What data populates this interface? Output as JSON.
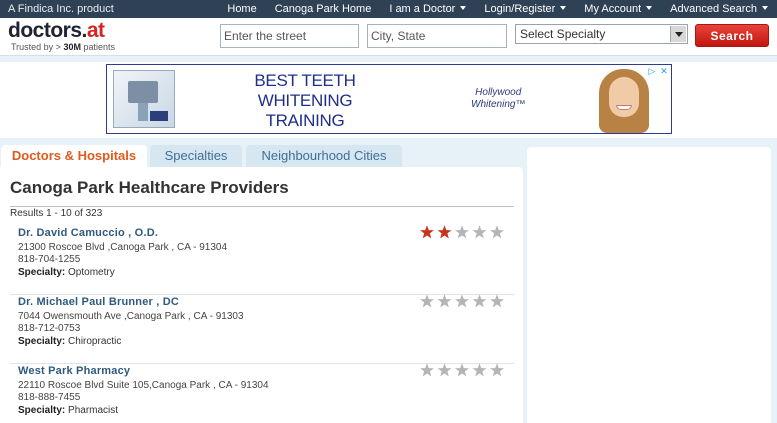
{
  "topbar": {
    "left_text": "A Findica Inc. product",
    "nav": [
      {
        "label": "Home",
        "has_caret": false
      },
      {
        "label": "Canoga Park Home",
        "has_caret": false
      },
      {
        "label": "I am a Doctor",
        "has_caret": true
      },
      {
        "label": "Login/Register",
        "has_caret": true
      },
      {
        "label": "My Account",
        "has_caret": true
      },
      {
        "label": "Advanced Search",
        "has_caret": true
      }
    ]
  },
  "header": {
    "logo_main": "doctors.",
    "logo_at": "at",
    "tagline_prefix": "Trusted by > ",
    "tagline_bold": "30M",
    "tagline_suffix": " patients",
    "street_placeholder": "Enter the street",
    "city_placeholder": "City, State",
    "specialty_selected": "Select Specialty",
    "search_label": "Search"
  },
  "ad": {
    "headline": [
      "BEST TEETH",
      "WHITENING",
      "TRAINING"
    ],
    "brand": [
      "Hollywood",
      "Whitening™"
    ],
    "icons": [
      "ad-choices-icon",
      "close-icon"
    ],
    "close_glyph": "✕"
  },
  "tabs": [
    {
      "label": "Doctors & Hospitals",
      "active": true
    },
    {
      "label": "Specialties",
      "active": false
    },
    {
      "label": "Neighbourhood Cities",
      "active": false
    }
  ],
  "main": {
    "title": "Canoga Park Healthcare Providers",
    "results_text": "Results 1 - 10 of 323",
    "specialty_label": "Specialty:",
    "listings": [
      {
        "name": "Dr. David Camuccio , O.D.",
        "address": "21300 Roscoe Blvd ,Canoga Park , CA - 91304",
        "phone": "818-704-1255",
        "specialty": "Optometry",
        "rating": 2
      },
      {
        "name": "Dr. Michael Paul Brunner , DC",
        "address": "7044 Owensmouth Ave ,Canoga Park , CA - 91303",
        "phone": "818-712-0753",
        "specialty": "Chiropractic",
        "rating": 0
      },
      {
        "name": "West Park Pharmacy",
        "address": "22110 Roscoe Blvd Suite 105,Canoga Park , CA - 91304",
        "phone": "818-888-7455",
        "specialty": "Pharmacist",
        "rating": 0
      }
    ]
  },
  "colors": {
    "topbar": "#2f4154",
    "accent_red": "#d8231d",
    "link_blue": "#2f5a7e",
    "star_on": "#c9331c",
    "star_off": "#b5b5b5"
  }
}
